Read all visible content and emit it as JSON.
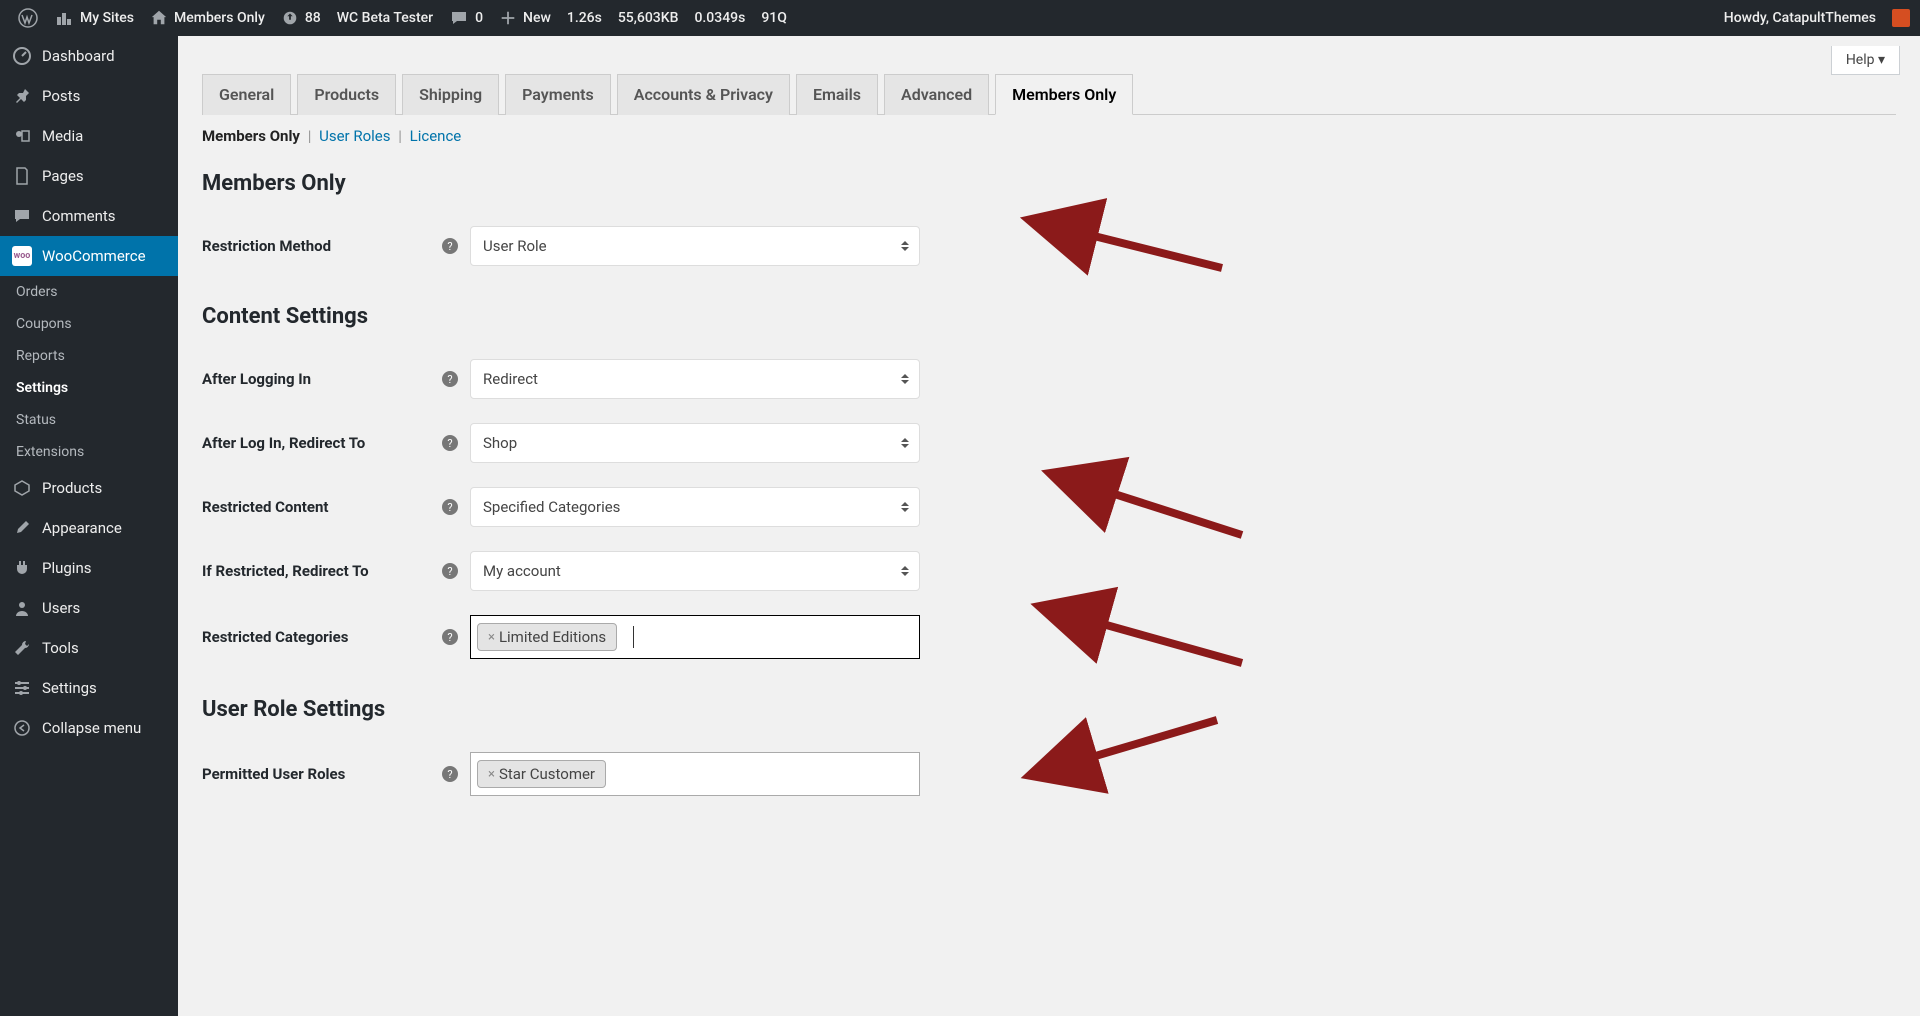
{
  "adminbar": {
    "my_sites": "My Sites",
    "site_name": "Members Only",
    "updates": "88",
    "beta": "WC Beta Tester",
    "comments": "0",
    "new": "New",
    "time": "1.26s",
    "memory": "55,603KB",
    "sql": "0.0349s",
    "queries": "91Q",
    "howdy": "Howdy, CatapultThemes"
  },
  "sidebar": {
    "dashboard": "Dashboard",
    "posts": "Posts",
    "media": "Media",
    "pages": "Pages",
    "comments": "Comments",
    "woocommerce": "WooCommerce",
    "orders": "Orders",
    "coupons": "Coupons",
    "reports": "Reports",
    "settings_sub": "Settings",
    "status": "Status",
    "extensions": "Extensions",
    "products": "Products",
    "appearance": "Appearance",
    "plugins": "Plugins",
    "users": "Users",
    "tools": "Tools",
    "settings": "Settings",
    "collapse": "Collapse menu"
  },
  "help": "Help ▾",
  "tabs": {
    "general": "General",
    "products": "Products",
    "shipping": "Shipping",
    "payments": "Payments",
    "accounts": "Accounts & Privacy",
    "emails": "Emails",
    "advanced": "Advanced",
    "members": "Members Only"
  },
  "subnav": {
    "members": "Members Only",
    "user_roles": "User Roles",
    "licence": "Licence"
  },
  "h_members": "Members Only",
  "h_content": "Content Settings",
  "h_roles": "User Role Settings",
  "fields": {
    "restriction_method": {
      "label": "Restriction Method",
      "value": "User Role"
    },
    "after_logging_in": {
      "label": "After Logging In",
      "value": "Redirect"
    },
    "after_login_redirect": {
      "label": "After Log In, Redirect To",
      "value": "Shop"
    },
    "restricted_content": {
      "label": "Restricted Content",
      "value": "Specified Categories"
    },
    "if_restricted_redirect": {
      "label": "If Restricted, Redirect To",
      "value": "My account"
    },
    "restricted_categories": {
      "label": "Restricted Categories",
      "token": "Limited Editions"
    },
    "permitted_roles": {
      "label": "Permitted User Roles",
      "token": "Star Customer"
    }
  }
}
